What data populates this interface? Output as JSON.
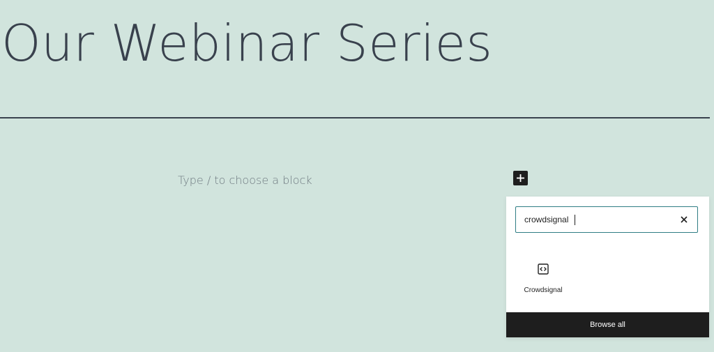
{
  "page": {
    "title": "Our Webinar Series"
  },
  "editor": {
    "placeholder": "Type / to choose a block"
  },
  "inserter": {
    "toggle_icon": "plus-icon",
    "search_value": "crowdsignal",
    "clear_icon": "close-icon",
    "results": [
      {
        "label": "Crowdsignal",
        "icon": "code-embed-icon"
      }
    ],
    "browse_all_label": "Browse all"
  },
  "colors": {
    "background": "#d1e4dd",
    "text": "#39414d",
    "search_border": "#2f7d84",
    "dark": "#1e1e1e"
  }
}
